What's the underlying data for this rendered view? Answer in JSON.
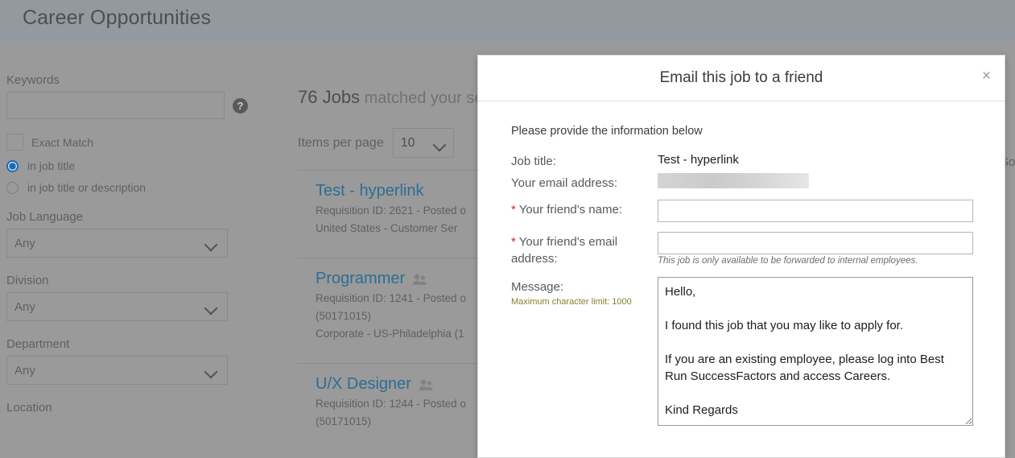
{
  "page": {
    "title": "Career Opportunities"
  },
  "filters": {
    "keywords_label": "Keywords",
    "keywords_value": "",
    "keywords_placeholder": "",
    "help_icon_glyph": "?",
    "exact_match_label": "Exact Match",
    "radio_in_job_title": "in job title",
    "radio_in_job_title_or_description": "in job title or description",
    "job_language_label": "Job Language",
    "job_language_value": "Any",
    "division_label": "Division",
    "division_value": "Any",
    "department_label": "Department",
    "department_value": "Any",
    "location_label": "Location"
  },
  "results": {
    "count": "76 Jobs",
    "count_suffix": " matched your sear",
    "items_per_page_label": "Items per page",
    "items_per_page_value": "10",
    "sort_by_label_clipped": "So",
    "jobs": [
      {
        "title": "Test - hyperlink",
        "has_people_icon": false,
        "line1": "Requisition ID: 2621 - Posted o",
        "line2": "United States  -  Customer Ser"
      },
      {
        "title": "Programmer",
        "has_people_icon": true,
        "line1": "Requisition ID: 1241 - Posted o",
        "line2": "(50171015)",
        "line3": "Corporate - US-Philadelphia (1"
      },
      {
        "title": "U/X Designer",
        "has_people_icon": true,
        "line1": "Requisition ID: 1244 - Posted o",
        "line2": "(50171015)"
      }
    ]
  },
  "modal": {
    "title": "Email this job to a friend",
    "close_glyph": "×",
    "intro": "Please provide the information below",
    "job_title_label": "Job title:",
    "job_title_value": "Test - hyperlink",
    "your_email_label": "Your email address:",
    "your_email_value": "",
    "friend_name_label": "Your friend's name:",
    "friend_name_value": "",
    "friend_name_required_mark": "*",
    "friend_email_label": "Your friend's email address:",
    "friend_email_value": "",
    "friend_email_required_mark": "*",
    "friend_email_note": "This job is only available to be forwarded to internal employees.",
    "message_label": "Message:",
    "message_limit_note": "Maximum character limit: 1000",
    "message_value": "Hello,\n\nI found this job that you may like to apply for.\n\nIf you are an existing employee, please log into Best Run SuccessFactors and access Careers.\n\nKind Regards"
  },
  "colors": {
    "overlay": "#9a9a9a",
    "header_bar": "#939a9f",
    "link": "#2c6e94",
    "required": "#dd1f1f",
    "note_olive": "#85802e",
    "accent_radio": "#1a6bb5"
  }
}
